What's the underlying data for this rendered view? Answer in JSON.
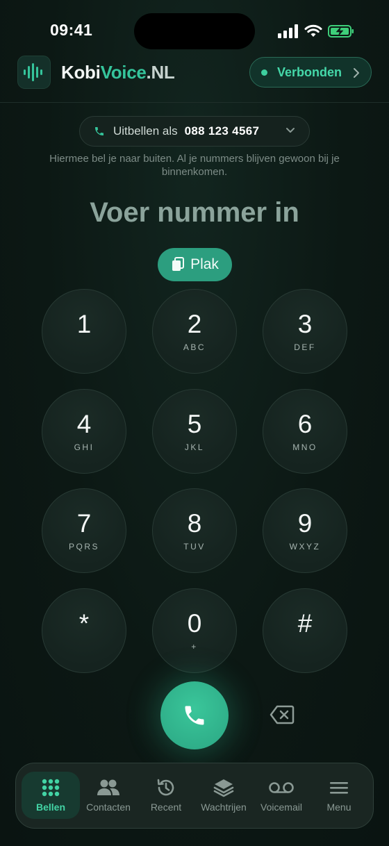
{
  "status_bar": {
    "time": "09:41"
  },
  "header": {
    "brand_part1": "Kobi",
    "brand_part2": "Voice",
    "brand_part3": ".NL",
    "connection_status": "Verbonden"
  },
  "caller_id": {
    "label": "Uitbellen als",
    "number": "088 123 4567",
    "hint": "Hiermee bel je naar buiten. Al je nummers blijven gewoon bij je binnenkomen."
  },
  "dialer": {
    "placeholder": "Voer nummer in",
    "paste_label": "Plak",
    "keys": [
      {
        "digit": "1",
        "letters": ""
      },
      {
        "digit": "2",
        "letters": "ABC"
      },
      {
        "digit": "3",
        "letters": "DEF"
      },
      {
        "digit": "4",
        "letters": "GHI"
      },
      {
        "digit": "5",
        "letters": "JKL"
      },
      {
        "digit": "6",
        "letters": "MNO"
      },
      {
        "digit": "7",
        "letters": "PQRS"
      },
      {
        "digit": "8",
        "letters": "TUV"
      },
      {
        "digit": "9",
        "letters": "WXYZ"
      },
      {
        "digit": "*",
        "letters": ""
      },
      {
        "digit": "0",
        "letters": "+"
      },
      {
        "digit": "#",
        "letters": ""
      }
    ]
  },
  "tabbar": {
    "tabs": [
      {
        "label": "Bellen",
        "icon": "keypad-grid-icon",
        "active": true
      },
      {
        "label": "Contacten",
        "icon": "contacts-icon",
        "active": false
      },
      {
        "label": "Recent",
        "icon": "history-icon",
        "active": false
      },
      {
        "label": "Wachtrijen",
        "icon": "layers-icon",
        "active": false
      },
      {
        "label": "Voicemail",
        "icon": "voicemail-icon",
        "active": false
      },
      {
        "label": "Menu",
        "icon": "menu-icon",
        "active": false
      }
    ]
  },
  "colors": {
    "accent": "#35c49b",
    "background": "#0d1a16",
    "call_button": "#2fb389"
  }
}
